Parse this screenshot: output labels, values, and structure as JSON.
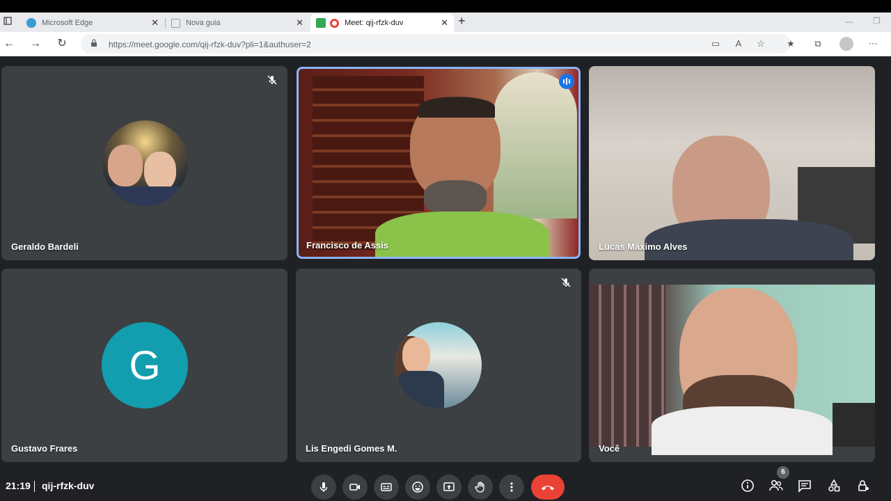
{
  "browser": {
    "tabs": [
      {
        "label": "Microsoft Edge"
      },
      {
        "label": "Nova guia"
      },
      {
        "label": "Meet: qij-rfzk-duv"
      }
    ],
    "url": "https://meet.google.com/qij-rfzk-duv?pli=1&authuser=2"
  },
  "participants": [
    {
      "name": "Geraldo Bardeli",
      "muted": true,
      "display": "photo-avatar"
    },
    {
      "name": "Francisco de Assis",
      "speaking": true,
      "display": "video"
    },
    {
      "name": "Lucas Máximo Alves",
      "display": "video"
    },
    {
      "name": "Gustavo Frares",
      "display": "initial-avatar",
      "initial": "G",
      "avatar_color": "#129eaf"
    },
    {
      "name": "Lis Engedi Gomes M.",
      "muted": true,
      "display": "photo-avatar"
    },
    {
      "name": "Você",
      "display": "video"
    }
  ],
  "bottombar": {
    "time": "21:19",
    "meeting_code": "qij-rfzk-duv",
    "participant_count": "6"
  },
  "colors": {
    "background": "#202124",
    "tile": "#3c4043",
    "speaking_border": "#8ab4f8",
    "end_call": "#ea4335"
  }
}
